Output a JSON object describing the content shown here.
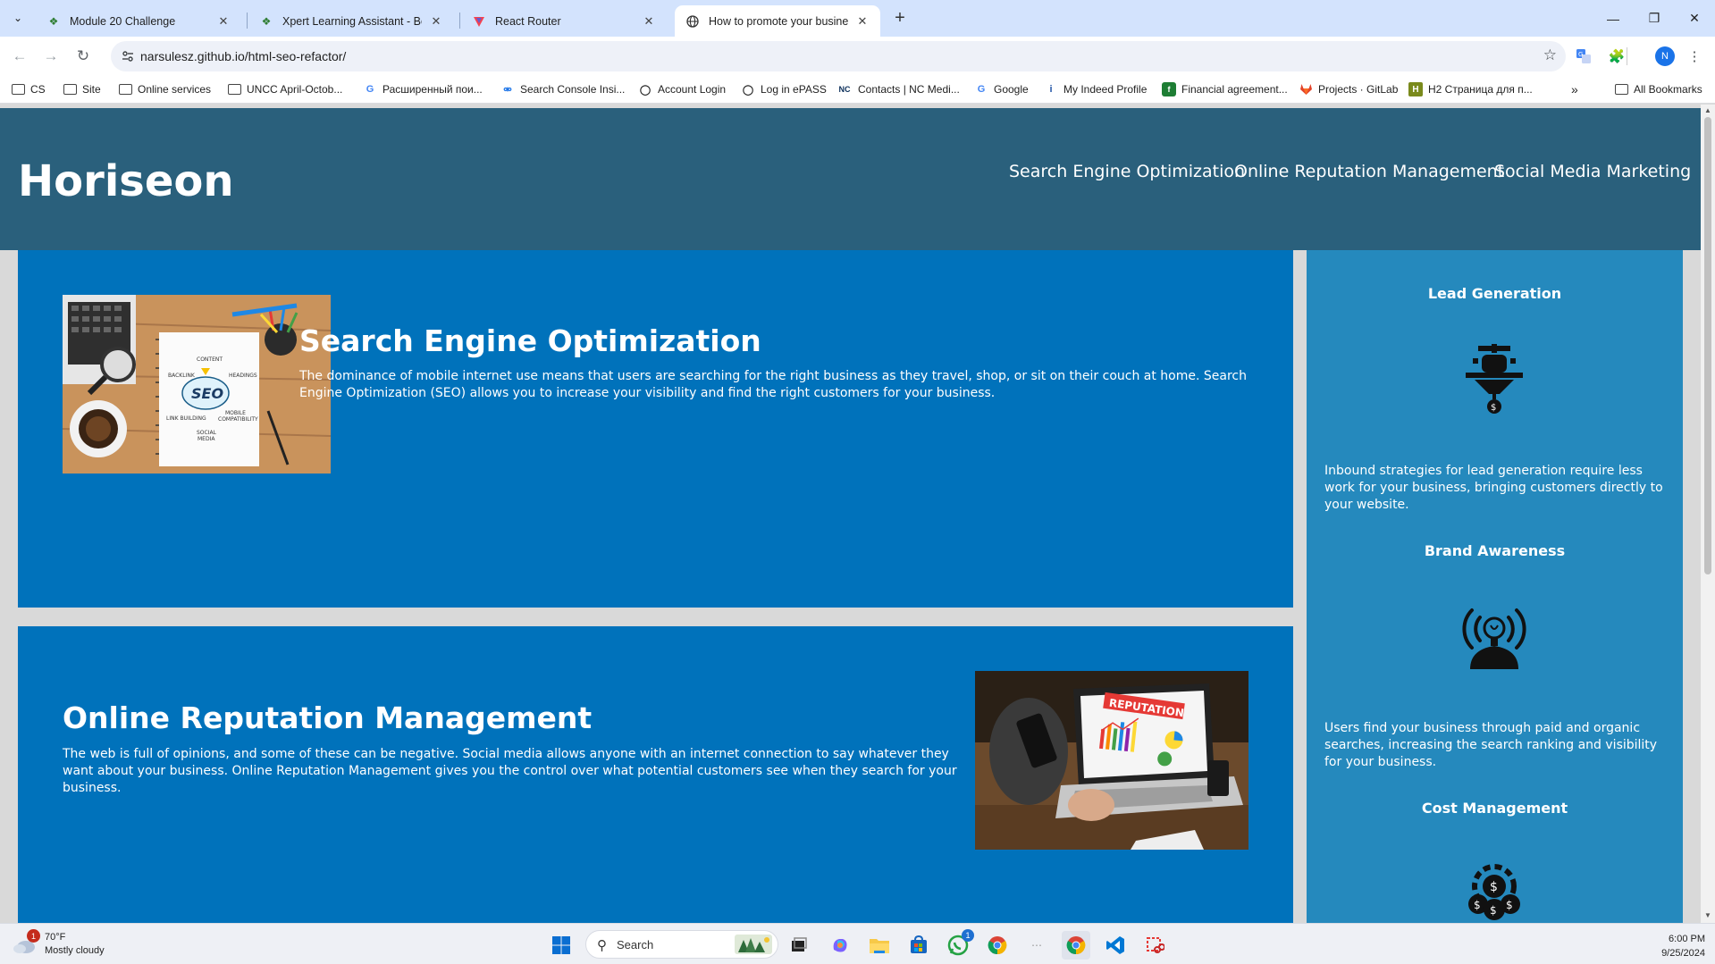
{
  "browser": {
    "tabs": [
      {
        "title": "Module 20 Challenge",
        "active": false
      },
      {
        "title": "Xpert Learning Assistant - Boot",
        "active": false
      },
      {
        "title": "React Router",
        "active": false
      },
      {
        "title": "How to promote your business",
        "active": true
      }
    ],
    "url": "narsulesz.github.io/html-seo-refactor/",
    "profile_initial": "N",
    "bookmarks": [
      {
        "label": "CS",
        "icon": "folder-icon"
      },
      {
        "label": "Site",
        "icon": "folder-icon"
      },
      {
        "label": "Online services",
        "icon": "folder-icon"
      },
      {
        "label": "UNCC April-Octob...",
        "icon": "folder-icon"
      },
      {
        "label": "Расширенный пои...",
        "icon": "google-icon"
      },
      {
        "label": "Search Console Insi...",
        "icon": "search-console-icon"
      },
      {
        "label": "Account Login",
        "icon": "globe-icon"
      },
      {
        "label": "Log in ePASS",
        "icon": "globe-icon"
      },
      {
        "label": "Contacts | NC Medi...",
        "icon": "nc-icon"
      },
      {
        "label": "Google",
        "icon": "google-icon"
      },
      {
        "label": "My Indeed Profile",
        "icon": "indeed-icon"
      },
      {
        "label": "Financial agreement...",
        "icon": "financial-icon"
      },
      {
        "label": "Projects · GitLab",
        "icon": "gitlab-icon"
      },
      {
        "label": "H2 Страница для п...",
        "icon": "h2-icon"
      }
    ],
    "nc_badge": "NC",
    "all_bookmarks": "All Bookmarks"
  },
  "site": {
    "logo": "Horiseon",
    "nav": [
      "Search Engine Optimization",
      "Online Reputation Management",
      "Social Media Marketing"
    ],
    "sections": [
      {
        "title": "Search Engine Optimization",
        "text": "The dominance of mobile internet use means that users are searching for the right business as they travel, shop, or sit on their couch at home. Search Engine Optimization (SEO) allows you to increase your visibility and find the right customers for your business."
      },
      {
        "title": "Online Reputation Management",
        "text": "The web is full of opinions, and some of these can be negative. Social media allows anyone with an internet connection to say whatever they want about your business. Online Reputation Management gives you the control over what potential customers see when they search for your business."
      }
    ],
    "seo_image_words": {
      "content": "CONTENT",
      "backlink": "BACKLINK",
      "headings": "HEADINGS",
      "seo": "SEO",
      "link_building": "LINK BUILDING",
      "mobile": "MOBILE",
      "compatibility": "COMPATIBILITY",
      "social": "SOCIAL",
      "media": "MEDIA"
    },
    "reputation_image_word": "REPUTATION",
    "benefits": [
      {
        "title": "Lead Generation",
        "icon": "lead-generation-icon",
        "text": "Inbound strategies for lead generation require less work for your business, bringing customers directly to your website."
      },
      {
        "title": "Brand Awareness",
        "icon": "brand-awareness-icon",
        "text": "Users find your business through paid and organic searches, increasing the search ranking and visibility for your business."
      },
      {
        "title": "Cost Management",
        "icon": "cost-management-icon",
        "text": ""
      }
    ],
    "colors": {
      "header": "#2a607c",
      "content": "#0072bb",
      "benefits": "#2589bd"
    }
  },
  "taskbar": {
    "weather_temp": "70°F",
    "weather_desc": "Mostly cloudy",
    "weather_badge": "1",
    "search_placeholder": "Search",
    "whatsapp_badge": "1",
    "time": "6:00 PM",
    "date": "9/25/2024"
  }
}
